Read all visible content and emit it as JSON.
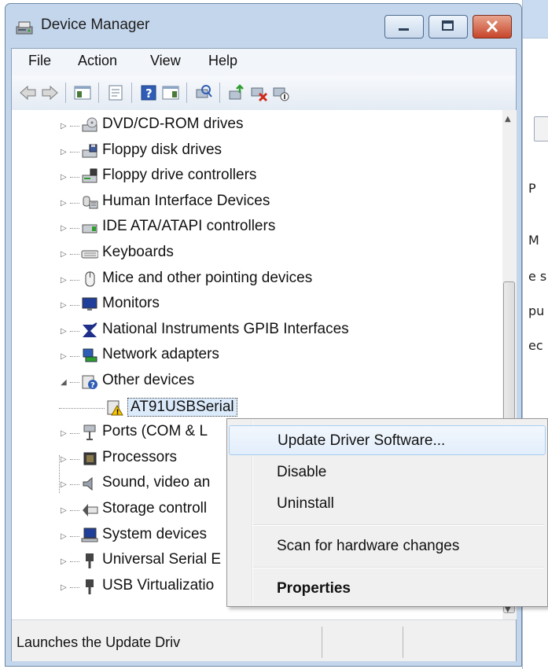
{
  "window": {
    "title": "Device Manager"
  },
  "menubar": {
    "items": [
      "File",
      "Action",
      "View",
      "Help"
    ]
  },
  "tree": {
    "items": [
      {
        "label": "DVD/CD-ROM drives",
        "icon": "dvd-drive-icon"
      },
      {
        "label": "Floppy disk drives",
        "icon": "floppy-disk-icon"
      },
      {
        "label": "Floppy drive controllers",
        "icon": "floppy-controller-icon"
      },
      {
        "label": "Human Interface Devices",
        "icon": "hid-icon"
      },
      {
        "label": "IDE ATA/ATAPI controllers",
        "icon": "ide-controller-icon"
      },
      {
        "label": "Keyboards",
        "icon": "keyboard-icon"
      },
      {
        "label": "Mice and other pointing devices",
        "icon": "mouse-icon"
      },
      {
        "label": "Monitors",
        "icon": "monitor-icon"
      },
      {
        "label": "National Instruments GPIB Interfaces",
        "icon": "ni-gpib-icon"
      },
      {
        "label": "Network adapters",
        "icon": "network-adapter-icon"
      },
      {
        "label": "Other devices",
        "icon": "unknown-device-icon",
        "expanded": true
      },
      {
        "label": "AT91USBSerial",
        "icon": "warning-device-icon",
        "child": true,
        "selected": true
      },
      {
        "label": "Ports (COM & L",
        "icon": "port-icon"
      },
      {
        "label": "Processors",
        "icon": "processor-icon"
      },
      {
        "label": "Sound, video an",
        "icon": "sound-icon"
      },
      {
        "label": "Storage controll",
        "icon": "storage-icon"
      },
      {
        "label": "System devices",
        "icon": "system-device-icon"
      },
      {
        "label": "Universal Serial E",
        "icon": "usb-icon"
      },
      {
        "label": "USB Virtualizatio",
        "icon": "usb-icon"
      }
    ]
  },
  "context_menu": {
    "items": [
      {
        "label": "Update Driver Software...",
        "highlighted": true
      },
      {
        "label": "Disable"
      },
      {
        "label": "Uninstall"
      },
      {
        "label": "Scan for hardware changes"
      },
      {
        "label": "Properties",
        "bold": true
      }
    ]
  },
  "statusbar": {
    "text": "Launches the Update Driv"
  },
  "background_window": {
    "fragments": [
      "P",
      "M",
      "e s",
      "pu",
      "ec"
    ]
  },
  "colors": {
    "frame": "#c4d6ec",
    "close_button": "#c7452a",
    "menu_highlight": "#a8cdf1"
  }
}
